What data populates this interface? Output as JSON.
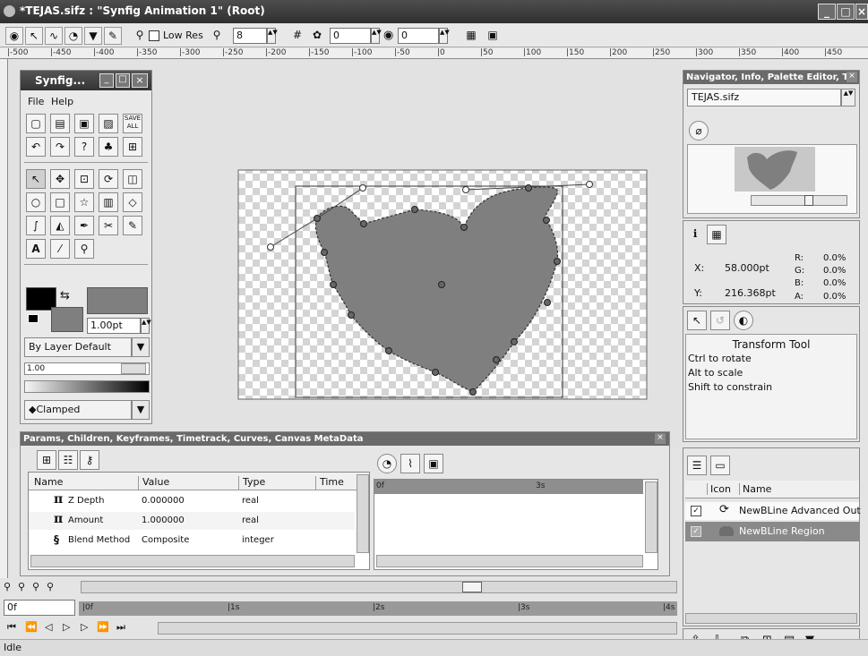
{
  "window": {
    "title": "*TEJAS.sifz : \"Synfig Animation 1\" (Root)"
  },
  "toolbar": {
    "lowres_label": "Low Res",
    "zoom_value": "8",
    "frame_value": "0",
    "time_value": "0"
  },
  "hruler": {
    "labels": [
      "-500",
      "-450",
      "-400",
      "-350",
      "-300",
      "-250",
      "-200",
      "-150",
      "-100",
      "-50",
      "0",
      "50",
      "100",
      "150",
      "200",
      "250",
      "300",
      "350",
      "400",
      "450"
    ]
  },
  "toolbox": {
    "title": "Synfig...",
    "menu": [
      "File",
      "Help"
    ],
    "width_value": "1.00pt",
    "blend_method": "By Layer Default",
    "amount": "1.00",
    "interpolation": "Clamped"
  },
  "navigator": {
    "title": "Navigator, Info, Palette Editor, T...",
    "file": "TEJAS.sifz"
  },
  "info": {
    "x_label": "X:",
    "x_value": "58.000pt",
    "y_label": "Y:",
    "y_value": "216.368pt",
    "r_label": "R:",
    "r_value": "0.0%",
    "g_label": "G:",
    "g_value": "0.0%",
    "b_label": "B:",
    "b_value": "0.0%",
    "a_label": "A:",
    "a_value": "0.0%"
  },
  "tool_options": {
    "title": "Transform Tool",
    "hints": [
      "Ctrl to rotate",
      "Alt to scale",
      "Shift to constrain"
    ]
  },
  "params": {
    "title": "Params, Children, Keyframes, Timetrack, Curves, Canvas MetaData",
    "columns": [
      "Name",
      "Value",
      "Type",
      "Time"
    ],
    "rows": [
      {
        "icon": "π",
        "name": "Z Depth",
        "value": "0.000000",
        "type": "real"
      },
      {
        "icon": "π",
        "name": "Amount",
        "value": "1.000000",
        "type": "real"
      },
      {
        "icon": "§",
        "name": "Blend Method",
        "value": "Composite",
        "type": "integer"
      }
    ],
    "track_labels": [
      "0f",
      "3s"
    ]
  },
  "layers": {
    "columns": [
      "Icon",
      "Name"
    ],
    "rows": [
      {
        "name": "NewBLine Advanced Out",
        "selected": false
      },
      {
        "name": "NewBLine Region",
        "selected": true
      }
    ]
  },
  "timebar": {
    "current": "0f",
    "labels": [
      "0f",
      "1s",
      "2s",
      "3s",
      "4s"
    ]
  },
  "status": {
    "text": "Idle"
  },
  "colors": {
    "shape_fill": "#7f7f7f",
    "title_bg": "#3a3a3a",
    "panel_title": "#6a6a6a",
    "selected_row": "#8a8a8a"
  }
}
